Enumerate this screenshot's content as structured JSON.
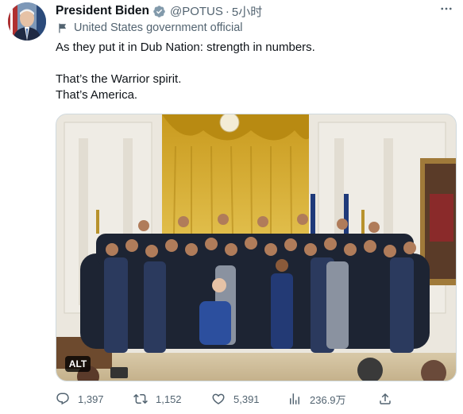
{
  "tweet": {
    "author_name": "President Biden",
    "handle": "@POTUS",
    "separator": "·",
    "time": "5小时",
    "account_label": "United States government official",
    "text_line_1": "As they put it in Dub Nation: strength in numbers.",
    "text_line_2": "That’s the Warrior spirit.",
    "text_line_3": "That’s America.",
    "media_alt_badge": "ALT",
    "more_icon": "more-horizontal-icon",
    "verified_color": "#829aab"
  },
  "stats": {
    "replies": "1,397",
    "retweets": "1,152",
    "likes": "5,391",
    "views": "236.9万"
  },
  "colors": {
    "secondary_text": "#536471",
    "primary_text": "#0f1419",
    "drape_gold": "#d4aa2a"
  }
}
